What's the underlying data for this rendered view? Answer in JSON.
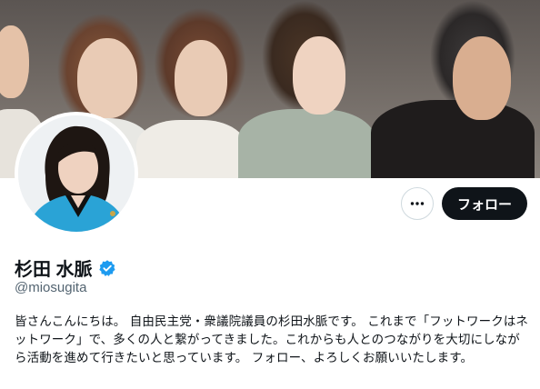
{
  "header": {
    "display_name": "杉田 水脈",
    "handle": "@miosugita",
    "verified_icon": "verified-badge-icon",
    "verified_color": "#1d9bf0"
  },
  "actions": {
    "more_icon": "more-horizontal-icon",
    "follow_label": "フォロー"
  },
  "bio": {
    "text": "皆さんこんにちは。 自由民主党・衆議院議員の杉田水脈です。 これまで「フットワークはネットワーク」で、多くの人と繋がってきました。これからも人とのつながりを大切にしながら活動を進めて行きたいと思っています。 フォロー、よろしくお願いいたします。"
  },
  "colors": {
    "follow_bg": "#0f1419",
    "text_primary": "#0f1419",
    "text_secondary": "#536471"
  }
}
